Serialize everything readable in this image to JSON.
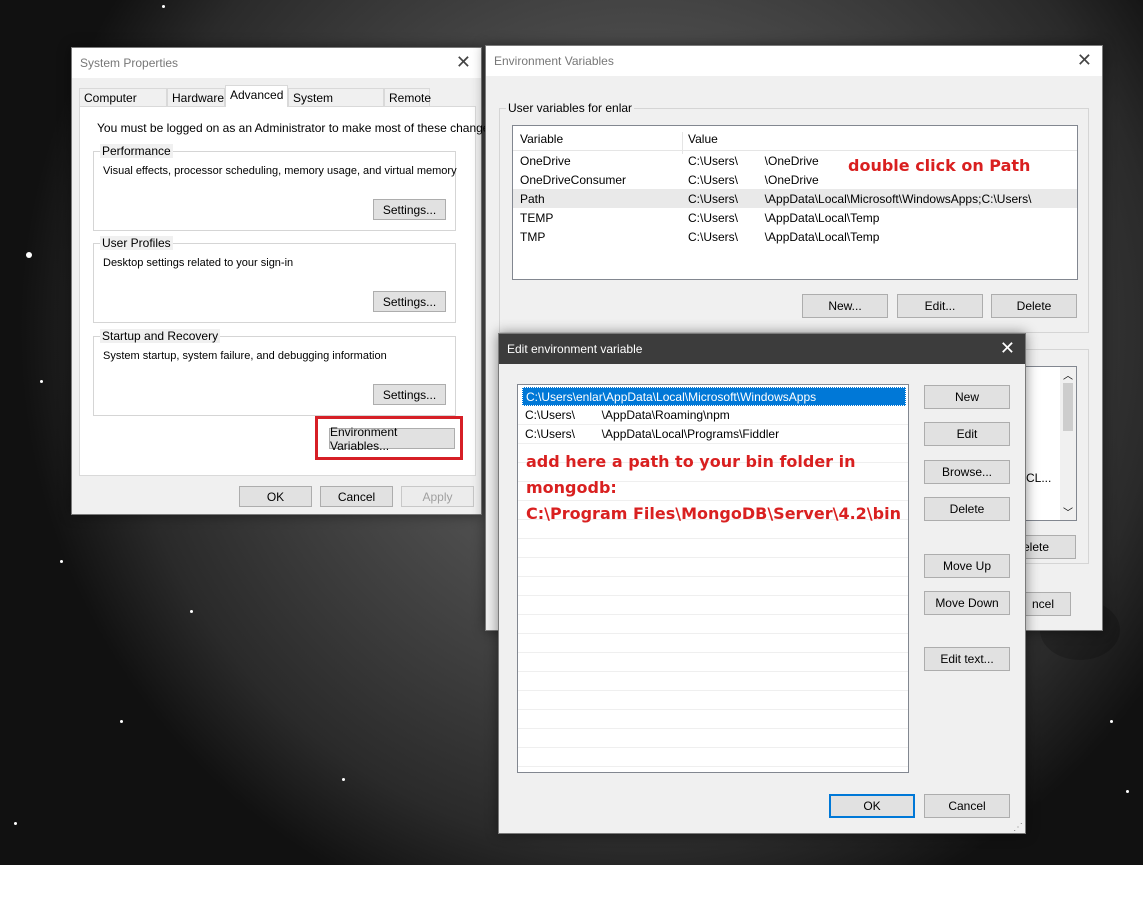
{
  "system_properties": {
    "title": "System Properties",
    "tabs": [
      "Computer Name",
      "Hardware",
      "Advanced",
      "System Protection",
      "Remote"
    ],
    "admin_note": "You must be logged on as an Administrator to make most of these changes.",
    "performance": {
      "label": "Performance",
      "desc": "Visual effects, processor scheduling, memory usage, and virtual memory",
      "button": "Settings..."
    },
    "user_profiles": {
      "label": "User Profiles",
      "desc": "Desktop settings related to your sign-in",
      "button": "Settings..."
    },
    "startup": {
      "label": "Startup and Recovery",
      "desc": "System startup, system failure, and debugging information",
      "button": "Settings..."
    },
    "env_button": "Environment Variables...",
    "ok": "OK",
    "cancel": "Cancel",
    "apply": "Apply"
  },
  "env_vars": {
    "title": "Environment Variables",
    "user_group": "User variables for enlar",
    "col_variable": "Variable",
    "col_value": "Value",
    "rows": [
      {
        "name": "OneDrive",
        "value": "C:\\Users\\        \\OneDrive"
      },
      {
        "name": "OneDriveConsumer",
        "value": "C:\\Users\\        \\OneDrive"
      },
      {
        "name": "Path",
        "value": "C:\\Users\\        \\AppData\\Local\\Microsoft\\WindowsApps;C:\\Users\\"
      },
      {
        "name": "TEMP",
        "value": "C:\\Users\\        \\AppData\\Local\\Temp"
      },
      {
        "name": "TMP",
        "value": "C:\\Users\\        \\AppData\\Local\\Temp"
      }
    ],
    "new": "New...",
    "edit": "Edit...",
    "delete": "Delete",
    "sys_partial_value": "CL...",
    "sys_delete_partial": "elete",
    "cancel_partial": "ncel"
  },
  "annotations": {
    "path_hint": "double click on Path",
    "add_line1": "add here a path to your bin folder in",
    "add_line2": "mongodb:",
    "add_line3": "C:\\Program Files\\MongoDB\\Server\\4.2\\bin"
  },
  "edit_env": {
    "title": "Edit environment variable",
    "entries": [
      "C:\\Users\\enlar\\AppData\\Local\\Microsoft\\WindowsApps",
      "C:\\Users\\        \\AppData\\Roaming\\npm",
      "C:\\Users\\        \\AppData\\Local\\Programs\\Fiddler"
    ],
    "buttons": {
      "new": "New",
      "edit": "Edit",
      "browse": "Browse...",
      "delete": "Delete",
      "move_up": "Move Up",
      "move_down": "Move Down",
      "edit_text": "Edit text...",
      "ok": "OK",
      "cancel": "Cancel"
    }
  }
}
